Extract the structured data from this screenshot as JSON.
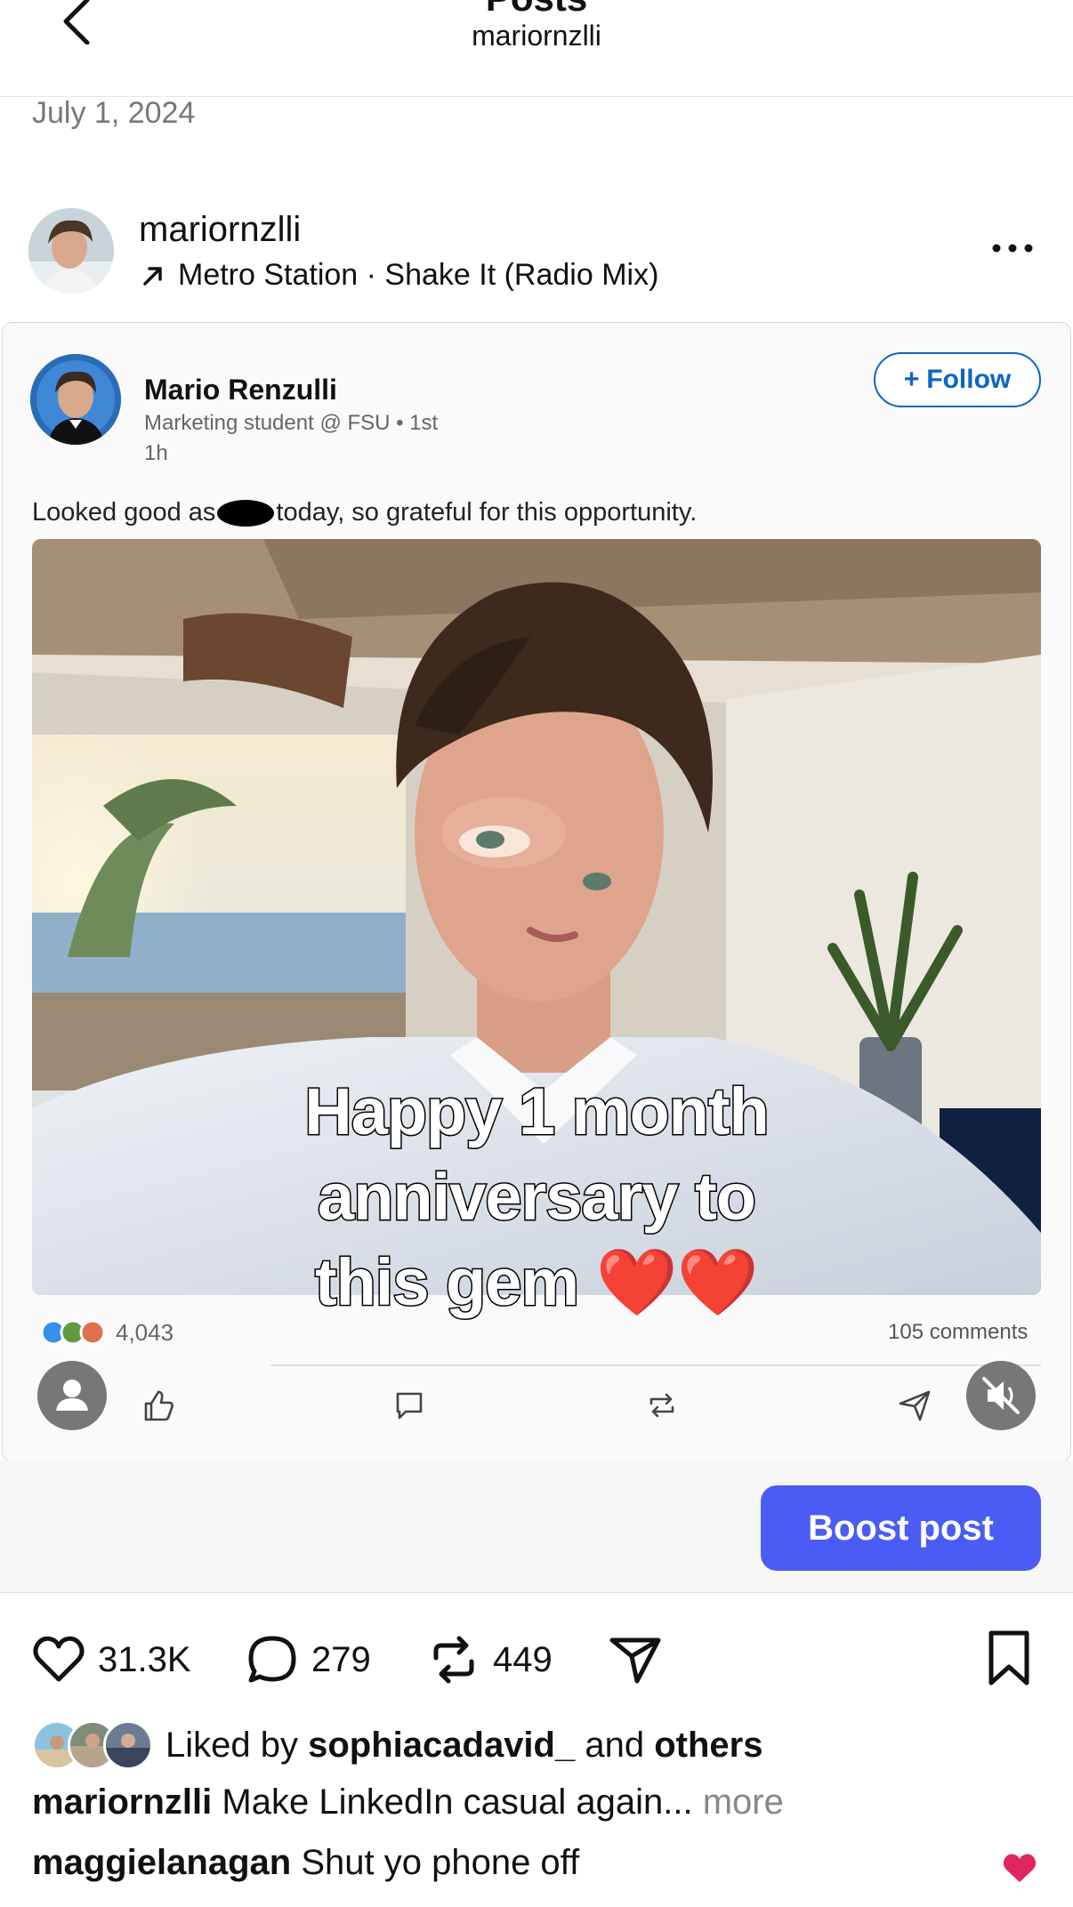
{
  "header": {
    "title": "Posts",
    "subtitle": "mariornzlli"
  },
  "post": {
    "date": "July 1, 2024",
    "username": "mariornzlli",
    "music": "Metro Station · Shake It (Radio Mix)",
    "caption_user": "mariornzlli",
    "caption_text": "Make LinkedIn casual again...",
    "caption_more": "more"
  },
  "linkedin_card": {
    "name": "Mario Renzulli",
    "headline": "Marketing student @ FSU • 1st",
    "time": "1h",
    "follow_label": "Follow",
    "follow_prefix": "+",
    "text_before": "Looked good as",
    "text_after": "today, so grateful for this opportunity.",
    "photo_caption_line1": "Happy 1 month",
    "photo_caption_line2": "anniversary to",
    "photo_caption_line3": "this gem",
    "photo_caption_emoji": "❤️❤️",
    "reaction_count": "4,043",
    "comments_count": "105 comments"
  },
  "boost": {
    "label": "Boost post"
  },
  "engagement": {
    "likes": "31.3K",
    "comments": "279",
    "reposts": "449"
  },
  "liked_by": {
    "prefix": "Liked by",
    "user": "sophiacadavid_",
    "middle": "and",
    "others": "others"
  },
  "top_comment": {
    "user": "maggielanagan",
    "text": "Shut yo phone off"
  },
  "colors": {
    "boost_blue": "#4a5cf4",
    "linkedin_blue": "#0a66c2",
    "heart_red": "#e0245e"
  }
}
